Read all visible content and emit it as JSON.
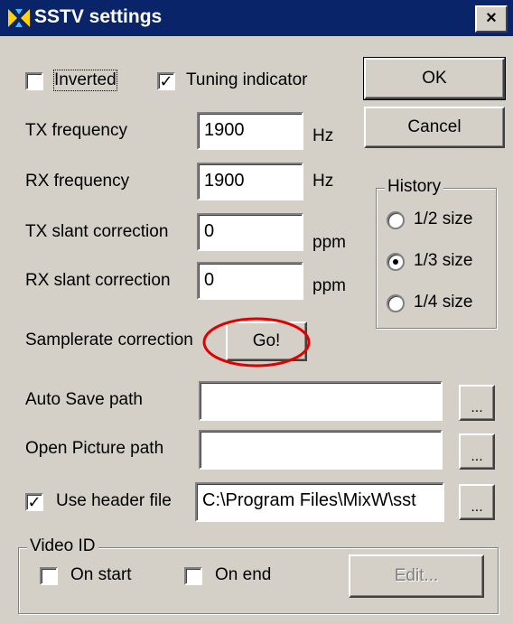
{
  "window": {
    "title": "SSTV settings",
    "close_label": "×"
  },
  "checkboxes": {
    "inverted": {
      "label": "Inverted",
      "checked": false
    },
    "tuning_indicator": {
      "label": "Tuning indicator",
      "checked": true
    },
    "use_header_file": {
      "label": "Use header file",
      "checked": true
    }
  },
  "buttons": {
    "ok": "OK",
    "cancel": "Cancel",
    "go": "Go!",
    "browse": "...",
    "edit": "Edit..."
  },
  "fields": {
    "tx_frequency": {
      "label": "TX frequency",
      "value": "1900",
      "unit": "Hz"
    },
    "rx_frequency": {
      "label": "RX frequency",
      "value": "1900",
      "unit": "Hz"
    },
    "tx_slant": {
      "label": "TX slant correction",
      "value": "0",
      "unit": "ppm"
    },
    "rx_slant": {
      "label": "RX slant correction",
      "value": "0",
      "unit": "ppm"
    },
    "auto_save_path": {
      "label": "Auto Save path",
      "value": ""
    },
    "open_picture_path": {
      "label": "Open Picture path",
      "value": ""
    },
    "header_file": {
      "value": "C:\\Program Files\\MixW\\sst"
    }
  },
  "samplerate": {
    "label": "Samplerate correction"
  },
  "history": {
    "title": "History",
    "options": [
      "1/2 size",
      "1/3 size",
      "1/4 size"
    ],
    "selected": "1/3 size"
  },
  "video_id": {
    "title": "Video ID",
    "on_start": {
      "label": "On start",
      "checked": false
    },
    "on_end": {
      "label": "On end",
      "checked": false
    }
  },
  "colors": {
    "titlebar": "#0a246a",
    "face": "#d4d0c8",
    "highlight_circle": "#e00000"
  }
}
